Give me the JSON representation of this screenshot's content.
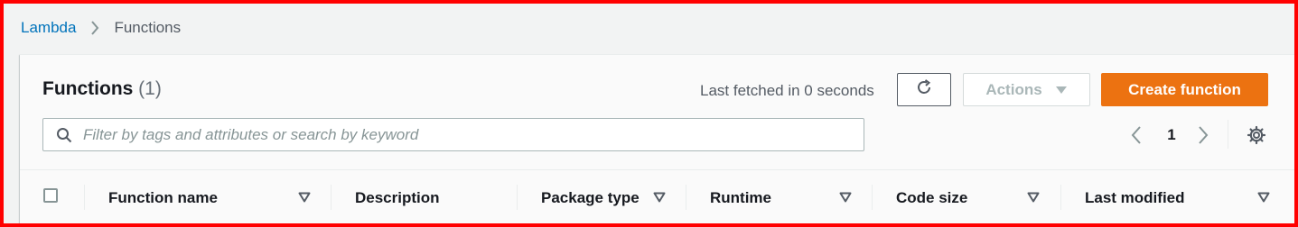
{
  "breadcrumb": {
    "items": [
      {
        "label": "Lambda"
      },
      {
        "label": "Functions"
      }
    ]
  },
  "header": {
    "title": "Functions",
    "count": "(1)",
    "last_fetched": "Last fetched in 0 seconds"
  },
  "toolbar": {
    "refresh_icon": "refresh-icon",
    "actions_label": "Actions",
    "create_label": "Create function"
  },
  "search": {
    "placeholder": "Filter by tags and attributes or search by keyword",
    "value": ""
  },
  "pagination": {
    "current_page": "1"
  },
  "table": {
    "columns": [
      {
        "label": "Function name"
      },
      {
        "label": "Description"
      },
      {
        "label": "Package type"
      },
      {
        "label": "Runtime"
      },
      {
        "label": "Code size"
      },
      {
        "label": "Last modified"
      }
    ]
  },
  "colors": {
    "link": "#0073bb",
    "primary": "#ec7211",
    "border_highlight": "#ff0000"
  }
}
